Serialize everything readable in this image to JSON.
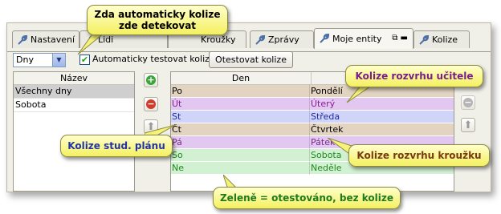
{
  "tabs": [
    {
      "label": "Nastavení",
      "icon": "wrench-icon"
    },
    {
      "label": "Lidi",
      "icon": "wrench-icon"
    },
    {
      "label": "Kroužky",
      "icon": "wrench-icon"
    },
    {
      "label": "Zprávy",
      "icon": "wrench-icon"
    },
    {
      "label": "Moje entity",
      "icon": "wrench-icon",
      "active": true,
      "extra": "⧉ ▬"
    },
    {
      "label": "Kolize",
      "icon": "wrench-icon"
    }
  ],
  "toolbar": {
    "combo_value": "Dny",
    "checkbox_label": "Automaticky testovat kolize",
    "checkbox_checked": true,
    "test_button": "Otestovat kolize"
  },
  "left_list": {
    "header": "Název",
    "items": [
      "Všechny dny",
      "Sobota"
    ]
  },
  "grid": {
    "header": "Den",
    "rows": [
      {
        "short": "Po",
        "day": "Pondělí",
        "color": "#e2d4c0"
      },
      {
        "short": "Út",
        "day": "Úterý",
        "color": "#e2c8f0"
      },
      {
        "short": "St",
        "day": "Středa",
        "color": "#d0d4f8"
      },
      {
        "short": "Čt",
        "day": "Čtvrtek",
        "color": "#e2d4c0"
      },
      {
        "short": "Pá",
        "day": "Pátek",
        "color": "#e2c8f0"
      },
      {
        "short": "So",
        "day": "Sobota",
        "color": "#d2f0d2"
      },
      {
        "short": "Ne",
        "day": "Neděle",
        "color": "#d2f0d2"
      }
    ]
  },
  "callouts": {
    "auto": "Zda automaticky kolize zde detekovat",
    "teacher": "Kolize rozvrhu učitele",
    "student": "Kolize stud. plánu",
    "club": "Kolize rozvrhu kroužku",
    "green": "Zeleně = otestováno, bez kolize"
  }
}
